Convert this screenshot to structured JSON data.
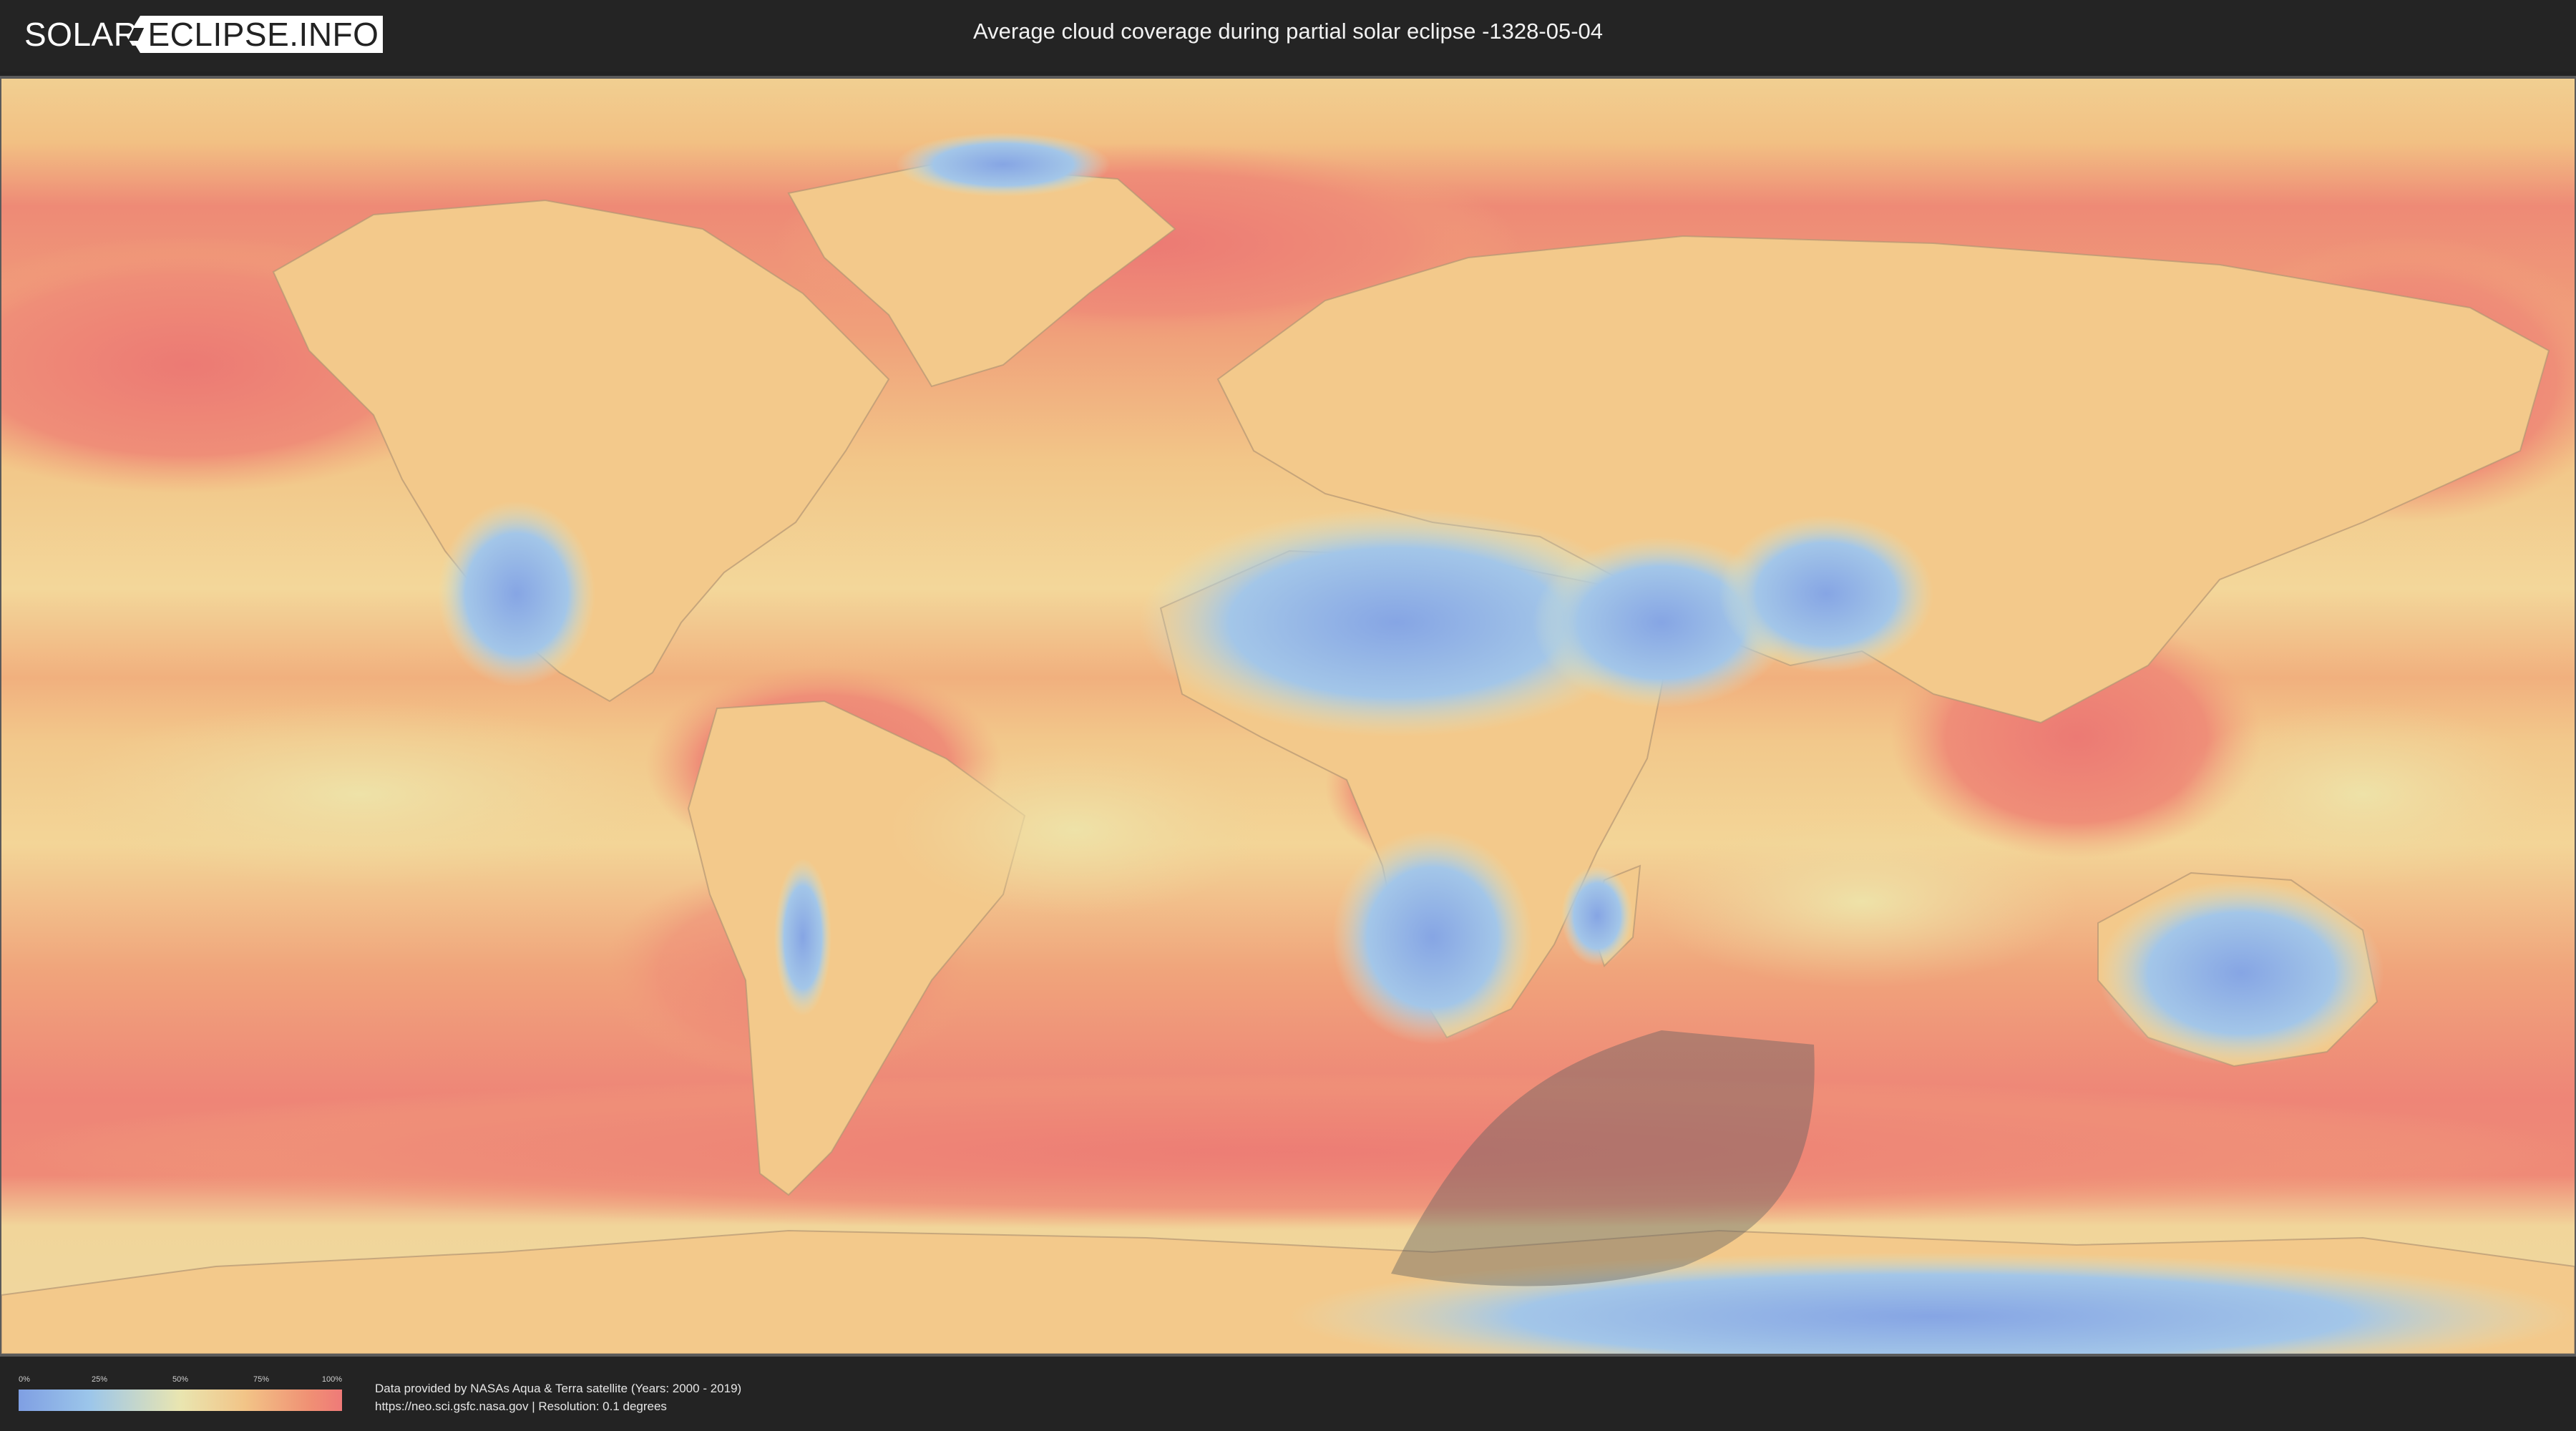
{
  "header": {
    "logo_left": "SOLAR",
    "logo_right": "ECLIPSE.INFO",
    "title": "Average cloud coverage during partial solar eclipse -1328-05-04"
  },
  "map": {
    "type": "cloud-coverage-world-map",
    "projection": "equirectangular",
    "eclipse_shadow_color": "#6b6b6b",
    "colors": {
      "clear": "#7f9fe3",
      "low": "#a9cbe8",
      "mid": "#ece5b2",
      "high": "#f3b783",
      "overcast": "#ef7f76"
    }
  },
  "legend": {
    "ticks": [
      "0%",
      "25%",
      "50%",
      "75%",
      "100%"
    ]
  },
  "footer": {
    "credit_line1": "Data provided by NASAs Aqua & Terra satellite (Years: 2000 - 2019)",
    "credit_line2": "https://neo.sci.gsfc.nasa.gov | Resolution: 0.1 degrees"
  }
}
